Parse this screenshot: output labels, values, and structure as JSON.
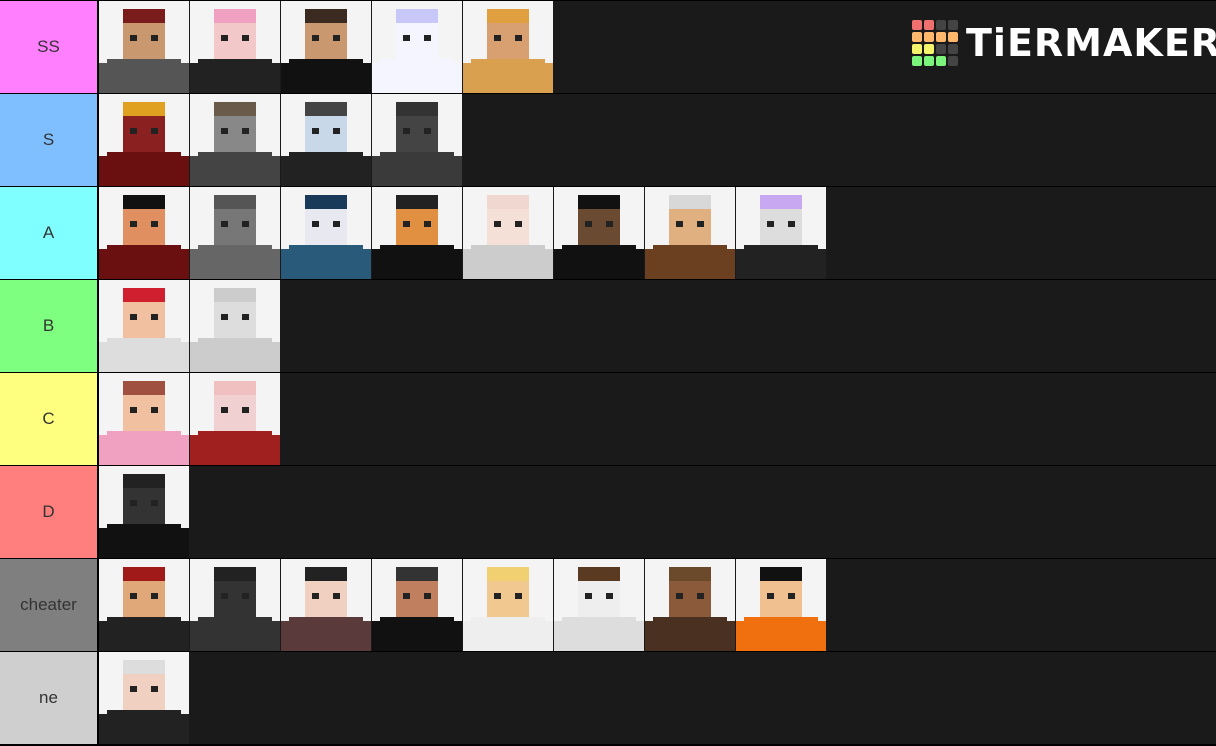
{
  "logo": {
    "text": "TiERMAKER",
    "grid": [
      "#f07070",
      "#f07070",
      "#444",
      "#444",
      "#ffb86c",
      "#ffb86c",
      "#ffb86c",
      "#ffb86c",
      "#f5f56c",
      "#f5f56c",
      "#444",
      "#444",
      "#7cf57c",
      "#7cf57c",
      "#7cf57c",
      "#444"
    ]
  },
  "tiers": [
    {
      "label": "SS",
      "color": "#ff7fff",
      "items": [
        [
          "#7a1c1c",
          "#c9986f",
          "#555"
        ],
        [
          "#f0a0c0",
          "#f3c8c8",
          "#222"
        ],
        [
          "#3a2a20",
          "#c9986f",
          "#111"
        ],
        [
          "#c8c8f8",
          "#f5f5ff",
          "#f5f5ff"
        ],
        [
          "#e0a040",
          "#d8a070",
          "#d9a050"
        ]
      ]
    },
    {
      "label": "S",
      "color": "#7fbfff",
      "items": [
        [
          "#e0a020",
          "#8a2020",
          "#6a1010"
        ],
        [
          "#6a5a4a",
          "#888",
          "#444"
        ],
        [
          "#444",
          "#c8d8e8",
          "#222"
        ],
        [
          "#333",
          "#444",
          "#3a3a3a"
        ]
      ]
    },
    {
      "label": "A",
      "color": "#7fffff",
      "items": [
        [
          "#111",
          "#e09060",
          "#6a1010"
        ],
        [
          "#555",
          "#777",
          "#666"
        ],
        [
          "#1a3a5a",
          "#e8e8f0",
          "#2a5a7a"
        ],
        [
          "#222",
          "#e09040",
          "#111"
        ],
        [
          "#f0d8d0",
          "#f5e0d8",
          "#ccc"
        ],
        [
          "#111",
          "#6a4a30",
          "#111"
        ],
        [
          "#d8d8d8",
          "#e0b080",
          "#6a4020"
        ],
        [
          "#c8a8f0",
          "#ddd",
          "#222"
        ]
      ]
    },
    {
      "label": "B",
      "color": "#7fff7f",
      "items": [
        [
          "#d02030",
          "#f0c0a0",
          "#ddd"
        ],
        [
          "#ccc",
          "#ddd",
          "#ccc"
        ]
      ]
    },
    {
      "label": "C",
      "color": "#ffff7f",
      "items": [
        [
          "#a05040",
          "#f0c0a0",
          "#f0a0c0"
        ],
        [
          "#f0c0c0",
          "#f0d0d0",
          "#a02020"
        ]
      ]
    },
    {
      "label": "D",
      "color": "#ff7f7f",
      "items": [
        [
          "#222",
          "#333",
          "#111"
        ]
      ]
    },
    {
      "label": "cheater",
      "color": "#7f7f7f",
      "items": [
        [
          "#a01a1a",
          "#e0a878",
          "#222"
        ],
        [
          "#222",
          "#333",
          "#333"
        ],
        [
          "#222",
          "#f0d0c0",
          "#5a3a3a"
        ],
        [
          "#333",
          "#c08060",
          "#111"
        ],
        [
          "#f0d070",
          "#f0c890",
          "#eee"
        ],
        [
          "#5a3a20",
          "#eee",
          "#ddd"
        ],
        [
          "#6a4a2a",
          "#8a5a3a",
          "#4a3020"
        ],
        [
          "#111",
          "#f0c090",
          "#f07010"
        ]
      ]
    },
    {
      "label": "ne",
      "color": "#cfcfcf",
      "items": [
        [
          "#ddd",
          "#f0d0c0",
          "#222"
        ]
      ]
    }
  ]
}
